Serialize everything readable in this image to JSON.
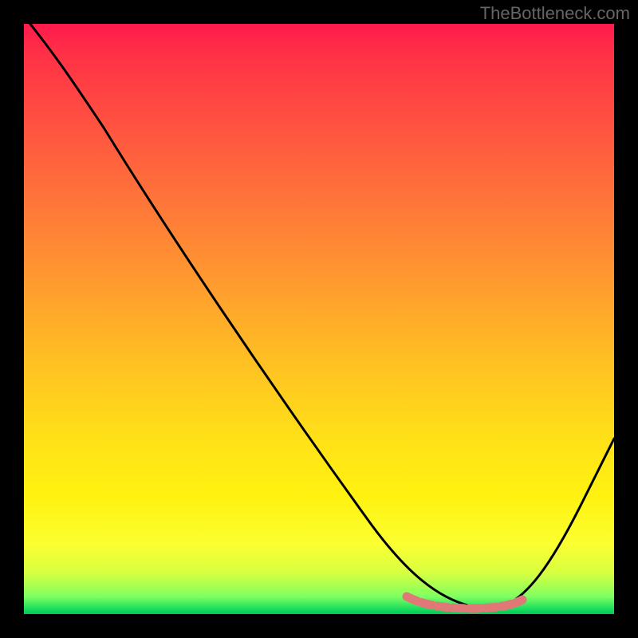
{
  "watermark": "TheBottleneck.com",
  "chart_data": {
    "type": "line",
    "title": "",
    "xlabel": "",
    "ylabel": "",
    "xlim": [
      0,
      100
    ],
    "ylim": [
      0,
      100
    ],
    "gradient_stops": [
      {
        "pos": 0,
        "color": "#ff1a4d"
      },
      {
        "pos": 50,
        "color": "#ffc020"
      },
      {
        "pos": 88,
        "color": "#fbff30"
      },
      {
        "pos": 100,
        "color": "#00c855"
      }
    ],
    "series": [
      {
        "name": "bottleneck-curve",
        "color": "#000000",
        "x": [
          0,
          5,
          12,
          20,
          30,
          40,
          50,
          58,
          64,
          68,
          72,
          76,
          80,
          84,
          90,
          95,
          100
        ],
        "values": [
          100,
          94,
          87,
          77,
          64,
          51,
          38,
          27,
          17,
          10,
          5,
          2,
          1,
          2,
          10,
          22,
          36
        ]
      },
      {
        "name": "optimal-band",
        "color": "#e88080",
        "x": [
          68,
          70,
          72,
          74,
          76,
          78,
          80,
          82,
          84
        ],
        "values": [
          4,
          3,
          2,
          1.5,
          1,
          1,
          1.5,
          2,
          3
        ]
      }
    ],
    "annotations": []
  }
}
